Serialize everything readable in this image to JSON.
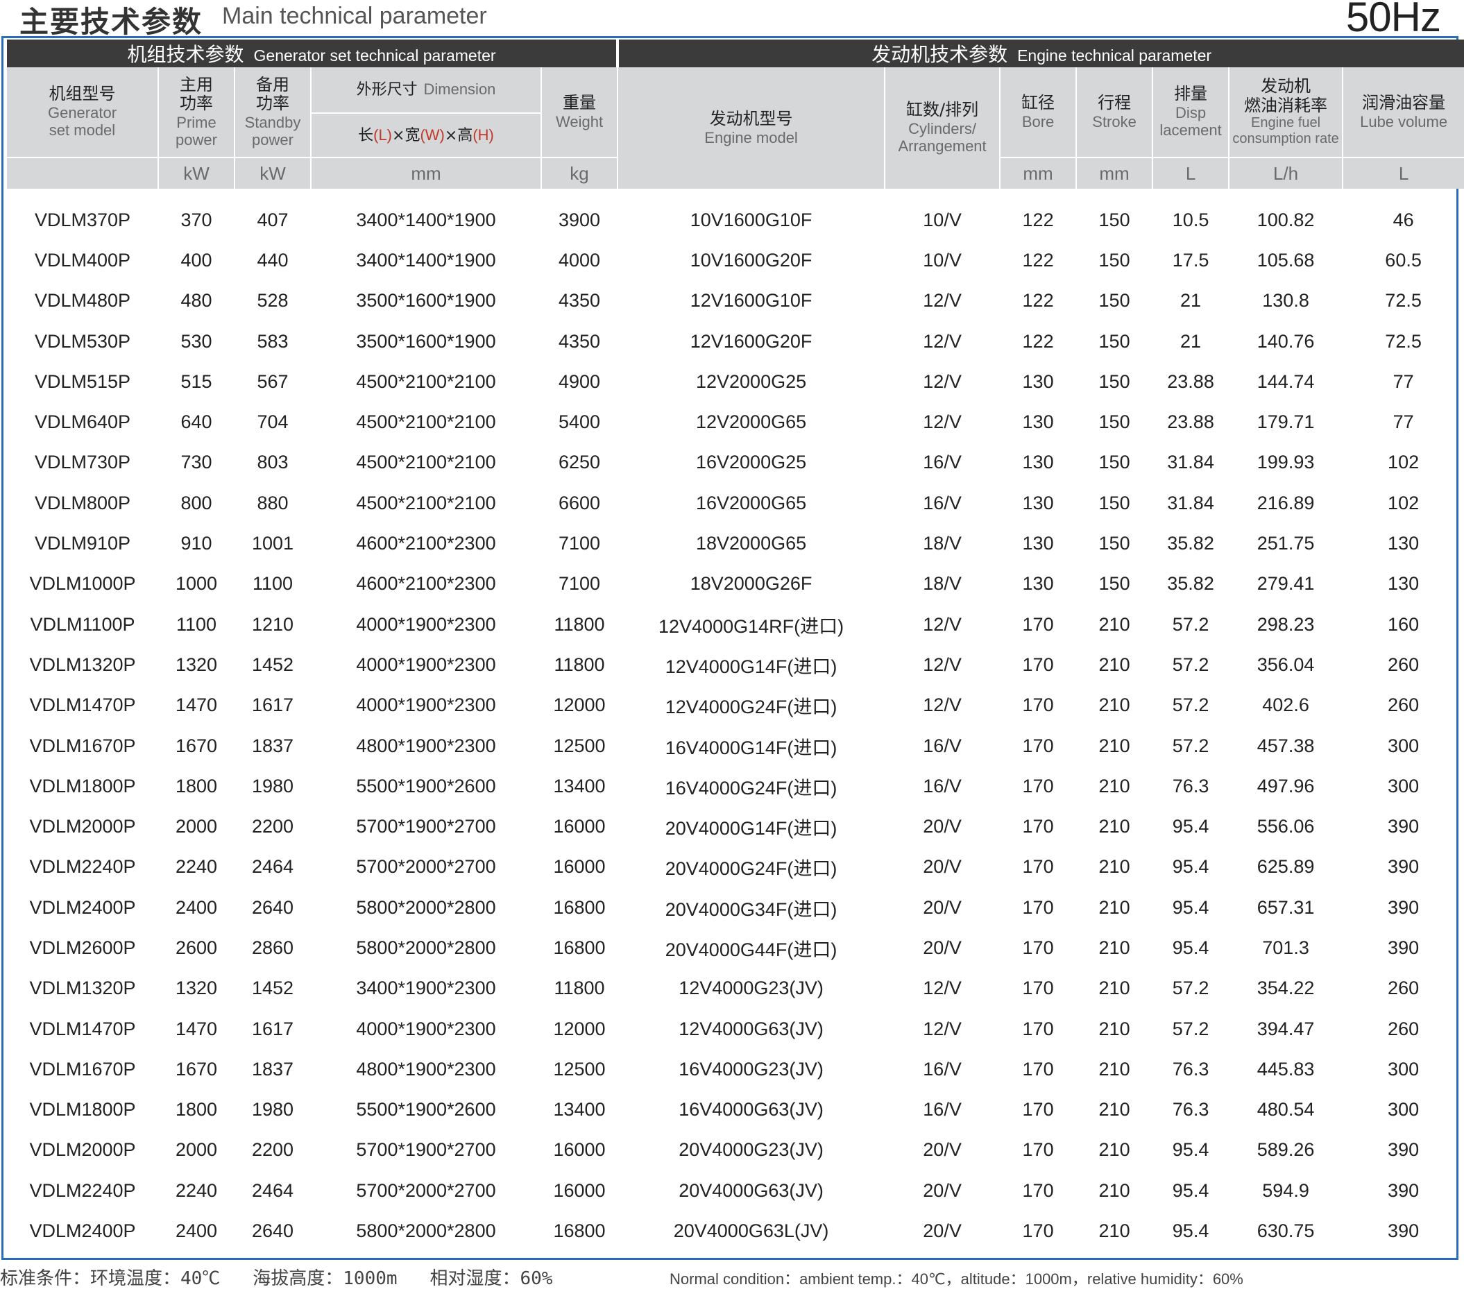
{
  "header": {
    "title_cn": "主要技术参数",
    "title_en": "Main technical parameter",
    "frequency": "50Hz"
  },
  "groups": {
    "generator_cn": "机组技术参数",
    "generator_en": "Generator set technical parameter",
    "engine_cn": "发动机技术参数",
    "engine_en": "Engine technical parameter"
  },
  "columns": {
    "model": {
      "cn": "机组型号",
      "en1": "Generator",
      "en2": "set model"
    },
    "prime": {
      "cn1": "主用",
      "cn2": "功率",
      "en1": "Prime",
      "en2": "power",
      "unit": "kW"
    },
    "standby": {
      "cn1": "备用",
      "cn2": "功率",
      "en1": "Standby",
      "en2": "power",
      "unit": "kW"
    },
    "dimension": {
      "cn": "外形尺寸",
      "en": "Dimension",
      "unit": "mm",
      "sub": {
        "l_cn": "长",
        "l_en": "(L)",
        "x1": "×",
        "w_cn": "宽",
        "w_en": "(W)",
        "x2": "×",
        "h_cn": "高",
        "h_en": "(H)"
      }
    },
    "weight": {
      "cn": "重量",
      "en": "Weight",
      "unit": "kg"
    },
    "engine_model": {
      "cn": "发动机型号",
      "en": "Engine model"
    },
    "cylinders": {
      "cn": "缸数/排列",
      "en1": "Cylinders/",
      "en2": "Arrangement"
    },
    "bore": {
      "cn": "缸径",
      "en": "Bore",
      "unit": "mm"
    },
    "stroke": {
      "cn": "行程",
      "en": "Stroke",
      "unit": "mm"
    },
    "displacement": {
      "cn": "排量",
      "en1": "Disp",
      "en2": "lacement",
      "unit": "L"
    },
    "fuel": {
      "cn1": "发动机",
      "cn2": "燃油消耗率",
      "en1": "Engine fuel",
      "en2": "consumption rate",
      "unit": "L/h"
    },
    "lube": {
      "cn": "润滑油容量",
      "en": "Lube volume",
      "unit": "L"
    }
  },
  "rows": [
    [
      "VDLM370P",
      "370",
      "407",
      "3400*1400*1900",
      "3900",
      "10V1600G10F",
      "10/V",
      "122",
      "150",
      "10.5",
      "100.82",
      "46"
    ],
    [
      "VDLM400P",
      "400",
      "440",
      "3400*1400*1900",
      "4000",
      "10V1600G20F",
      "10/V",
      "122",
      "150",
      "17.5",
      "105.68",
      "60.5"
    ],
    [
      "VDLM480P",
      "480",
      "528",
      "3500*1600*1900",
      "4350",
      "12V1600G10F",
      "12/V",
      "122",
      "150",
      "21",
      "130.8",
      "72.5"
    ],
    [
      "VDLM530P",
      "530",
      "583",
      "3500*1600*1900",
      "4350",
      "12V1600G20F",
      "12/V",
      "122",
      "150",
      "21",
      "140.76",
      "72.5"
    ],
    [
      "VDLM515P",
      "515",
      "567",
      "4500*2100*2100",
      "4900",
      "12V2000G25",
      "12/V",
      "130",
      "150",
      "23.88",
      "144.74",
      "77"
    ],
    [
      "VDLM640P",
      "640",
      "704",
      "4500*2100*2100",
      "5400",
      "12V2000G65",
      "12/V",
      "130",
      "150",
      "23.88",
      "179.71",
      "77"
    ],
    [
      "VDLM730P",
      "730",
      "803",
      "4500*2100*2100",
      "6250",
      "16V2000G25",
      "16/V",
      "130",
      "150",
      "31.84",
      "199.93",
      "102"
    ],
    [
      "VDLM800P",
      "800",
      "880",
      "4500*2100*2100",
      "6600",
      "16V2000G65",
      "16/V",
      "130",
      "150",
      "31.84",
      "216.89",
      "102"
    ],
    [
      "VDLM910P",
      "910",
      "1001",
      "4600*2100*2300",
      "7100",
      "18V2000G65",
      "18/V",
      "130",
      "150",
      "35.82",
      "251.75",
      "130"
    ],
    [
      "VDLM1000P",
      "1000",
      "1100",
      "4600*2100*2300",
      "7100",
      "18V2000G26F",
      "18/V",
      "130",
      "150",
      "35.82",
      "279.41",
      "130"
    ],
    [
      "VDLM1100P",
      "1100",
      "1210",
      "4000*1900*2300",
      "11800",
      "12V4000G14RF(进口)",
      "12/V",
      "170",
      "210",
      "57.2",
      "298.23",
      "160"
    ],
    [
      "VDLM1320P",
      "1320",
      "1452",
      "4000*1900*2300",
      "11800",
      "12V4000G14F(进口)",
      "12/V",
      "170",
      "210",
      "57.2",
      "356.04",
      "260"
    ],
    [
      "VDLM1470P",
      "1470",
      "1617",
      "4000*1900*2300",
      "12000",
      "12V4000G24F(进口)",
      "12/V",
      "170",
      "210",
      "57.2",
      "402.6",
      "260"
    ],
    [
      "VDLM1670P",
      "1670",
      "1837",
      "4800*1900*2300",
      "12500",
      "16V4000G14F(进口)",
      "16/V",
      "170",
      "210",
      "57.2",
      "457.38",
      "300"
    ],
    [
      "VDLM1800P",
      "1800",
      "1980",
      "5500*1900*2600",
      "13400",
      "16V4000G24F(进口)",
      "16/V",
      "170",
      "210",
      "76.3",
      "497.96",
      "300"
    ],
    [
      "VDLM2000P",
      "2000",
      "2200",
      "5700*1900*2700",
      "16000",
      "20V4000G14F(进口)",
      "20/V",
      "170",
      "210",
      "95.4",
      "556.06",
      "390"
    ],
    [
      "VDLM2240P",
      "2240",
      "2464",
      "5700*2000*2700",
      "16000",
      "20V4000G24F(进口)",
      "20/V",
      "170",
      "210",
      "95.4",
      "625.89",
      "390"
    ],
    [
      "VDLM2400P",
      "2400",
      "2640",
      "5800*2000*2800",
      "16800",
      "20V4000G34F(进口)",
      "20/V",
      "170",
      "210",
      "95.4",
      "657.31",
      "390"
    ],
    [
      "VDLM2600P",
      "2600",
      "2860",
      "5800*2000*2800",
      "16800",
      "20V4000G44F(进口)",
      "20/V",
      "170",
      "210",
      "95.4",
      "701.3",
      "390"
    ],
    [
      "VDLM1320P",
      "1320",
      "1452",
      "3400*1900*2300",
      "11800",
      "12V4000G23(JV)",
      "12/V",
      "170",
      "210",
      "57.2",
      "354.22",
      "260"
    ],
    [
      "VDLM1470P",
      "1470",
      "1617",
      "4000*1900*2300",
      "12000",
      "12V4000G63(JV)",
      "12/V",
      "170",
      "210",
      "57.2",
      "394.47",
      "260"
    ],
    [
      "VDLM1670P",
      "1670",
      "1837",
      "4800*1900*2300",
      "12500",
      "16V4000G23(JV)",
      "16/V",
      "170",
      "210",
      "76.3",
      "445.83",
      "300"
    ],
    [
      "VDLM1800P",
      "1800",
      "1980",
      "5500*1900*2600",
      "13400",
      "16V4000G63(JV)",
      "16/V",
      "170",
      "210",
      "76.3",
      "480.54",
      "300"
    ],
    [
      "VDLM2000P",
      "2000",
      "2200",
      "5700*1900*2700",
      "16000",
      "20V4000G23(JV)",
      "20/V",
      "170",
      "210",
      "95.4",
      "589.26",
      "390"
    ],
    [
      "VDLM2240P",
      "2240",
      "2464",
      "5700*2000*2700",
      "16000",
      "20V4000G63(JV)",
      "20/V",
      "170",
      "210",
      "95.4",
      "594.9",
      "390"
    ],
    [
      "VDLM2400P",
      "2400",
      "2640",
      "5800*2000*2800",
      "16800",
      "20V4000G63L(JV)",
      "20/V",
      "170",
      "210",
      "95.4",
      "630.75",
      "390"
    ]
  ],
  "footer": {
    "cn": "标准条件：环境温度：40℃   海拔高度：1000m   相对湿度：60%",
    "en": "Normal condition：ambient temp.：40℃，altitude：1000m，relative humidity：60%"
  },
  "colors": {
    "group_bar": "#3b3b3b",
    "header_bg": "#d6d7d9",
    "frame": "#2b6cb6",
    "accent_red": "#c0392b"
  }
}
